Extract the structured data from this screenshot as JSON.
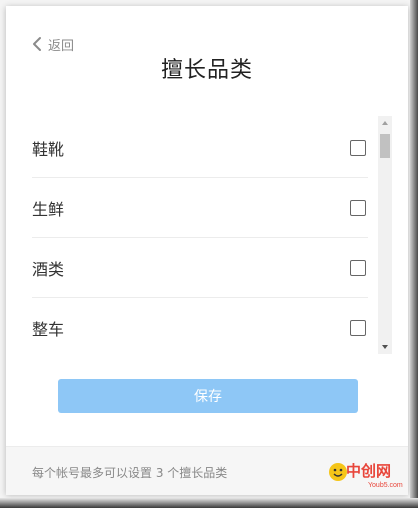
{
  "header": {
    "back_label": "返回",
    "title": "擅长品类"
  },
  "categories": [
    {
      "label": "鞋靴",
      "checked": false
    },
    {
      "label": "生鲜",
      "checked": false
    },
    {
      "label": "酒类",
      "checked": false
    },
    {
      "label": "整车",
      "checked": false
    }
  ],
  "save_label": "保存",
  "footer_note": "每个帐号最多可以设置 3 个擅长品类",
  "watermark": {
    "text": "中创网",
    "sub": "Youb5.com"
  },
  "colors": {
    "save_button": "#8ec7f6",
    "watermark": "#e8463b"
  }
}
